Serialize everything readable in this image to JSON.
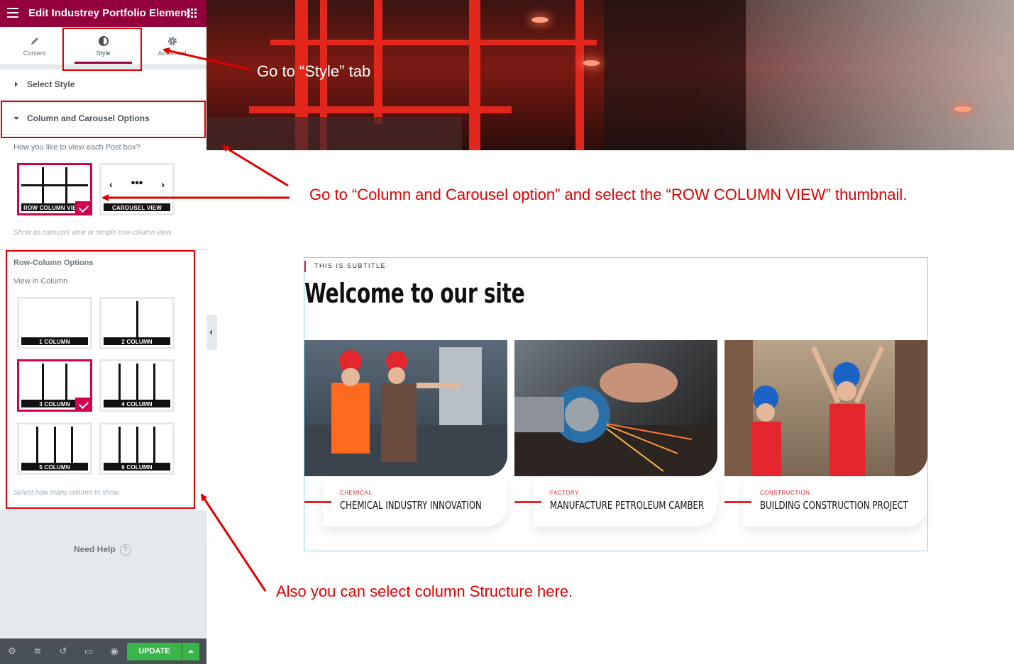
{
  "editor": {
    "title": "Edit Industrey Portfolio Element",
    "tabs": [
      {
        "label": "Content",
        "icon": "pencil-icon"
      },
      {
        "label": "Style",
        "icon": "half-circle-icon"
      },
      {
        "label": "Advanced",
        "icon": "gear-icon"
      }
    ],
    "active_tab": "Style",
    "sections": {
      "select_style": "Select Style",
      "column_carousel": "Column and Carousel Options"
    },
    "view_question": "How you like to view each Post box?",
    "view_options": [
      "ROW COLUMN VIEW",
      "CAROUSEL VIEW"
    ],
    "view_selected": "ROW COLUMN VIEW",
    "view_help": "Show as carousel view or simple row-column view.",
    "row_column_heading": "Row-Column Options",
    "view_in_column_label": "View in Column",
    "column_options": [
      "1 COLUMN",
      "2 COLUMN",
      "3 COLUMN",
      "4 COLUMN",
      "5 COLUMN",
      "6 COLUMN"
    ],
    "column_selected": "3 COLUMN",
    "column_help": "Select how many column to show.",
    "need_help": "Need Help",
    "update_button": "UPDATE"
  },
  "preview": {
    "subtitle": "THIS IS SUBTITLE",
    "heading": "Welcome to our site",
    "cards": [
      {
        "category": "CHEMICAL",
        "title": "CHEMICAL INDUSTRY INNOVATION"
      },
      {
        "category": "FACTORY",
        "title": "MANUFACTURE PETROLEUM CAMBER"
      },
      {
        "category": "CONSTRUCTION",
        "title": "BUILDING CONSTRUCTION PROJECT"
      }
    ]
  },
  "annotations": {
    "style_tab": "Go  to “Style” tab",
    "column_carousel": "Go to “Column and Carousel option” and select the “ROW COLUMN VIEW” thumbnail.",
    "column_structure": "Also you can select column Structure here."
  },
  "colors": {
    "brand": "#93003c",
    "accent": "#d3004f",
    "annotation": "#e10000",
    "update_green": "#39b54a",
    "card_accent": "#e3262e"
  }
}
